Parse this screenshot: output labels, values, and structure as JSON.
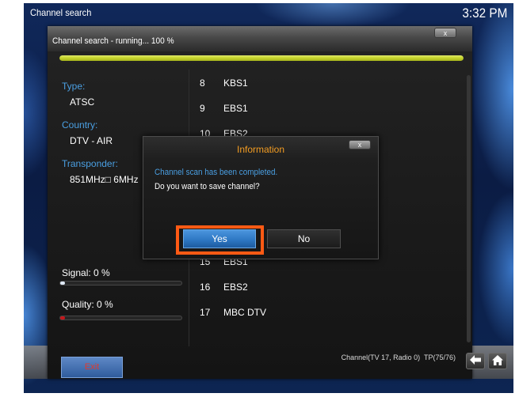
{
  "window": {
    "title": "Channel search",
    "clock": "3:32 PM"
  },
  "panel": {
    "title": "Channel search - running... 100 %",
    "close_label": "x",
    "progress_percent": 100
  },
  "info": {
    "type_label": "Type:",
    "type_value": "ATSC",
    "country_label": "Country:",
    "country_value": "DTV - AIR",
    "transponder_label": "Transponder:",
    "transponder_value": "851MHz□ 6MHz"
  },
  "signal": {
    "label": "Signal: 0 %",
    "percent": 0
  },
  "quality": {
    "label": "Quality: 0 %",
    "percent": 0
  },
  "channels": [
    {
      "number": "8",
      "name": "KBS1"
    },
    {
      "number": "9",
      "name": "EBS1"
    },
    {
      "number": "10",
      "name": "EBS2"
    },
    {
      "number": "15",
      "name": "EBS1"
    },
    {
      "number": "16",
      "name": "EBS2"
    },
    {
      "number": "17",
      "name": "MBC DTV"
    }
  ],
  "footer": {
    "exit_label": "Exit",
    "summary": "Channel(TV 17, Radio 0)  TP(75/76)"
  },
  "nav": {
    "back_icon": "back-arrow-icon",
    "home_icon": "home-icon"
  },
  "dialog": {
    "title": "Information",
    "close_label": "x",
    "message": "Channel scan has been completed.",
    "question": "Do you want to save channel?",
    "yes_label": "Yes",
    "no_label": "No"
  },
  "colors": {
    "label_blue": "#4a9fe2",
    "dialog_title_orange": "#f29c22",
    "progress_green": "#c7d52e",
    "focus_highlight": "#ff5a14",
    "exit_text_red": "#e23a2c",
    "yes_button_blue": "#2e78c4",
    "signal_indicator": "#dfe9f5",
    "quality_indicator": "#c4181c"
  }
}
